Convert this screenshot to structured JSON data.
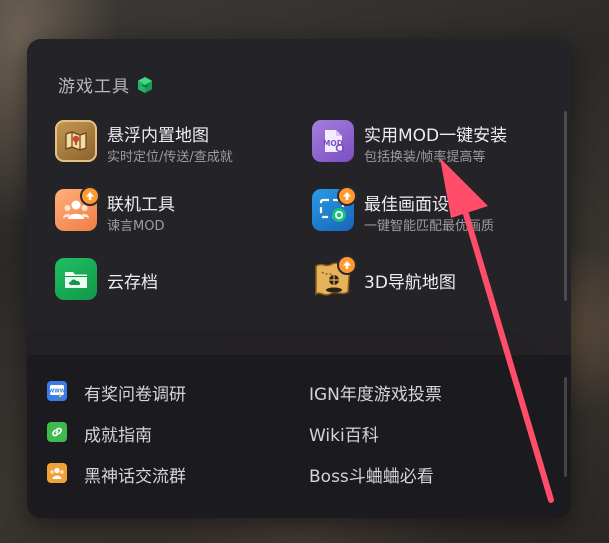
{
  "panel": {
    "section_title": "游戏工具",
    "tools": [
      {
        "name": "悬浮内置地图",
        "sub": "实时定位/传送/查成就",
        "icon": "map-icon"
      },
      {
        "name": "实用MOD一键安装",
        "sub": "包括换装/帧率提高等",
        "icon": "mod-file-icon"
      },
      {
        "name": "联机工具",
        "sub": "谏言MOD",
        "icon": "team-icon"
      },
      {
        "name": "最佳画面设置",
        "sub": "一键智能匹配最优画质",
        "icon": "display-settings-icon"
      },
      {
        "name": "云存档",
        "sub": "",
        "icon": "cloud-folder-icon"
      },
      {
        "name": "3D导航地图",
        "sub": "",
        "icon": "treasure-map-icon"
      }
    ],
    "links_left": [
      {
        "label": "有奖问卷调研",
        "icon": "survey-icon"
      },
      {
        "label": "成就指南",
        "icon": "link-icon"
      },
      {
        "label": "黑神话交流群",
        "icon": "group-icon"
      }
    ],
    "links_right": [
      "IGN年度游戏投票",
      "Wiki百科",
      "Boss斗蛐蛐必看"
    ]
  },
  "colors": {
    "accent_arrow": "#ff4d6a",
    "cube_icon": "#2ecc71"
  }
}
